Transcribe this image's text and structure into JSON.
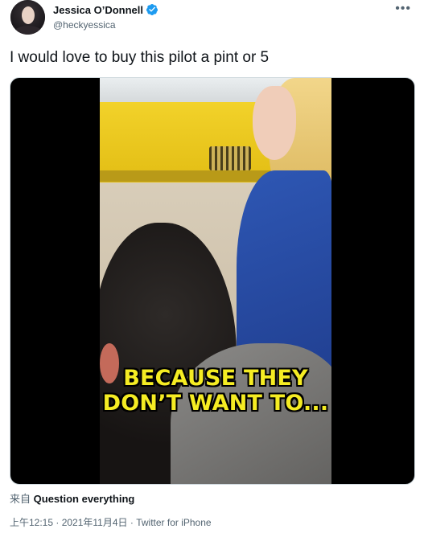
{
  "author": {
    "display_name": "Jessica O’Donnell",
    "handle": "@heckyessica",
    "verified_icon": "verified-badge-icon"
  },
  "more_icon": "more-options-icon",
  "tweet": {
    "text": "I would love to buy this pilot a pint or 5"
  },
  "media": {
    "type": "video",
    "caption_line1": "BECAUSE THEY",
    "caption_line2": "DON’T WANT TO..."
  },
  "source": {
    "prefix": "来自",
    "link_text": "Question everything"
  },
  "meta": {
    "time": "上午12:15",
    "separator1": " · ",
    "date": "2021年11月4日",
    "separator2": " · ",
    "client": "Twitter for iPhone"
  },
  "colors": {
    "text_primary": "#0f1419",
    "text_secondary": "#536471",
    "verified_blue": "#1d9bf0",
    "caption_yellow": "#f5ec23"
  }
}
